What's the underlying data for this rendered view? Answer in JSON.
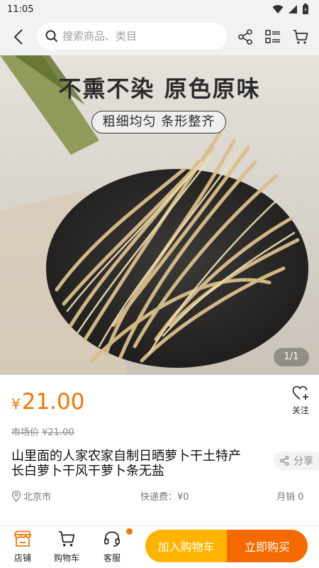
{
  "status_bar": {
    "time": "11:05",
    "icons": [
      "wifi-icon",
      "signal-icon",
      "battery-icon"
    ]
  },
  "header": {
    "back_icon": "chevron-left-icon",
    "search_placeholder": "搜索商品、类目",
    "search_icon": "search-icon",
    "actions": [
      "share-icon",
      "category-list-icon",
      "cart-icon"
    ]
  },
  "product_image": {
    "headline": "不熏不染 原色原味",
    "tagline": "粗细均匀 条形整齐",
    "counter": "1/1"
  },
  "price": {
    "currency": "¥",
    "amount": "21.00",
    "market_label": "市场价",
    "market_value": "¥21.00"
  },
  "follow": {
    "label": "关注",
    "icon": "heart-plus-icon"
  },
  "product": {
    "title": "山里面的人家农家自制日晒萝卜干土特产长白萝卜干风干萝卜条无盐"
  },
  "share": {
    "label": "分享",
    "icon": "share-icon"
  },
  "info": {
    "location": "北京市",
    "shipping": "快递费：¥0",
    "sales": "月销  0"
  },
  "bottom_nav": {
    "items": [
      {
        "label": "店铺",
        "icon": "store-icon"
      },
      {
        "label": "购物车",
        "icon": "cart-icon"
      },
      {
        "label": "客服",
        "icon": "headset-icon"
      }
    ],
    "add_to_cart": "加入购物车",
    "buy_now": "立即购买"
  },
  "colors": {
    "accent": "#f07800",
    "cart_button": "#ffb400",
    "buy_button": "#f56a00",
    "header_bg": "#f2f2f2"
  }
}
